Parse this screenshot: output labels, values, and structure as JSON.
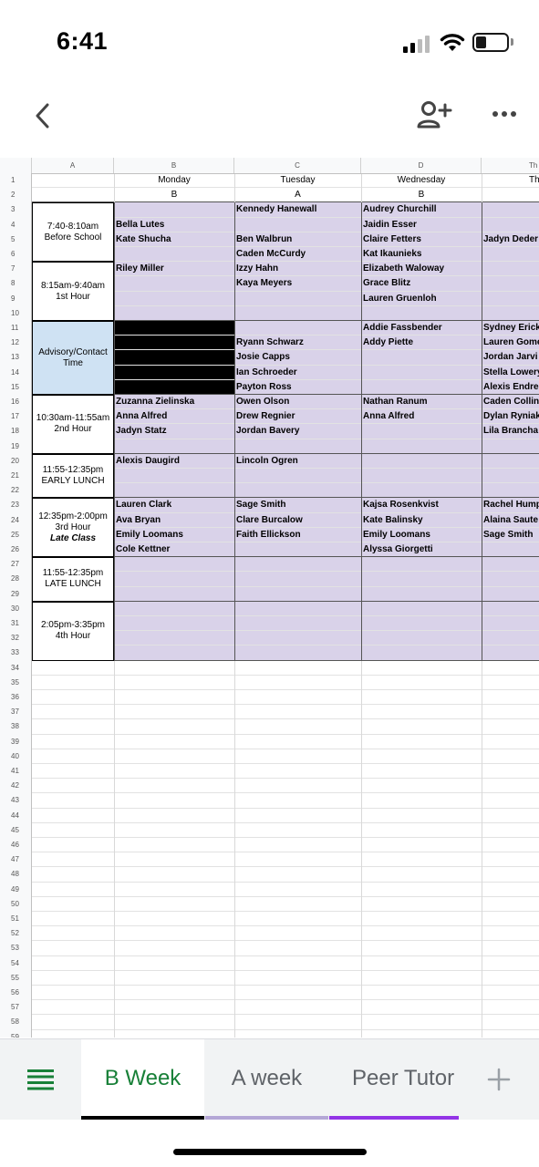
{
  "status_bar": {
    "time": "6:41"
  },
  "toolbar": {
    "back_icon": "chevron-left-icon",
    "share_icon": "add-person-icon",
    "more_icon": "more-dots-icon"
  },
  "columns": {
    "A": "A",
    "B": "B",
    "C": "C",
    "D": "D",
    "E": "Th"
  },
  "days": {
    "B": "Monday",
    "C": "Tuesday",
    "D": "Wednesday",
    "E": "Th"
  },
  "week_letters": {
    "B": "B",
    "C": "A",
    "D": "B"
  },
  "rows": [
    "1",
    "2",
    "3",
    "4",
    "5",
    "6",
    "7",
    "8",
    "9",
    "10",
    "11",
    "12",
    "13",
    "14",
    "15",
    "16",
    "17",
    "18",
    "19",
    "20",
    "21",
    "22",
    "23",
    "24",
    "25",
    "26",
    "27",
    "28",
    "29",
    "30",
    "31",
    "32",
    "33",
    "34",
    "35",
    "36",
    "37",
    "38",
    "39",
    "40",
    "41",
    "42",
    "43",
    "44",
    "45",
    "46",
    "47",
    "48",
    "49",
    "50",
    "51",
    "52",
    "53",
    "54",
    "55",
    "56",
    "57",
    "58",
    "59"
  ],
  "time_slots": [
    {
      "line1": "7:40-8:10am",
      "line2": "Before School",
      "line3": ""
    },
    {
      "line1": "8:15am-9:40am",
      "line2": "1st Hour",
      "line3": ""
    },
    {
      "line1": "Advisory/Contact",
      "line2": "Time",
      "line3": ""
    },
    {
      "line1": "10:30am-11:55am",
      "line2": "2nd Hour",
      "line3": ""
    },
    {
      "line1": "11:55-12:35pm",
      "line2": "EARLY LUNCH",
      "line3": ""
    },
    {
      "line1": "12:35pm-2:00pm",
      "line2": "3rd Hour",
      "line3": "Late Class"
    },
    {
      "line1": "11:55-12:35pm",
      "line2": "LATE LUNCH",
      "line3": ""
    },
    {
      "line1": "2:05pm-3:35pm",
      "line2": "4th Hour",
      "line3": ""
    }
  ],
  "names": {
    "B": {
      "4": "Bella Lutes",
      "5": "Kate Shucha",
      "7": "Riley Miller",
      "16": "Zuzanna Zielinska",
      "17": "Anna Alfred",
      "18": "Jadyn Statz",
      "20": "Alexis Daugird",
      "23": "Lauren Clark",
      "24": "Ava Bryan",
      "25": "Emily Loomans",
      "26": "Cole Kettner"
    },
    "C": {
      "3": "Kennedy Hanewall",
      "5": "Ben Walbrun",
      "6": "Caden McCurdy",
      "7": "Izzy Hahn",
      "8": "Kaya Meyers",
      "12": "Ryann Schwarz",
      "13": "Josie Capps",
      "14": "Ian Schroeder",
      "15": "Payton Ross",
      "16": "Owen Olson",
      "17": "Drew Regnier",
      "18": "Jordan Bavery",
      "20": "Lincoln Ogren",
      "23": "Sage Smith",
      "24": "Clare Burcalow",
      "25": "Faith Ellickson"
    },
    "D": {
      "3": "Audrey Churchill",
      "4": "Jaidin Esser",
      "5": "Claire Fetters",
      "6": "Kat Ikaunieks",
      "7": "Elizabeth Waloway",
      "8": "Grace Blitz",
      "9": "Lauren Gruenloh",
      "11": "Addie Fassbender",
      "12": "Addy Piette",
      "16": "Nathan Ranum",
      "17": "Anna Alfred",
      "23": "Kajsa Rosenkvist",
      "24": "Kate Balinsky",
      "25": "Emily Loomans",
      "26": "Alyssa Giorgetti"
    },
    "E": {
      "5": "Jadyn Deder",
      "11": "Sydney Erick",
      "12": "Lauren Gome",
      "13": "Jordan Jarvi",
      "14": "Stella Lowery",
      "15": "Alexis Endre",
      "16": "Caden Collin",
      "17": "Dylan Ryniak",
      "18": "Lila Brancha",
      "23": "Rachel Hump",
      "24": "Alaina Saute",
      "25": "Sage Smith"
    }
  },
  "tabs": [
    {
      "label": "B Week",
      "active": true,
      "underline": "#000000"
    },
    {
      "label": "A week",
      "active": false,
      "underline": "#b4a7d6"
    },
    {
      "label": "Peer Tutor",
      "active": false,
      "underline": "#9334e6"
    }
  ],
  "tabs_menu_icon": "list-icon",
  "add_sheet_icon": "plus-icon",
  "colors": {
    "purple_fill": "#d9d2e9",
    "advisory_blue": "#cfe2f3",
    "active_tab": "#188038"
  }
}
